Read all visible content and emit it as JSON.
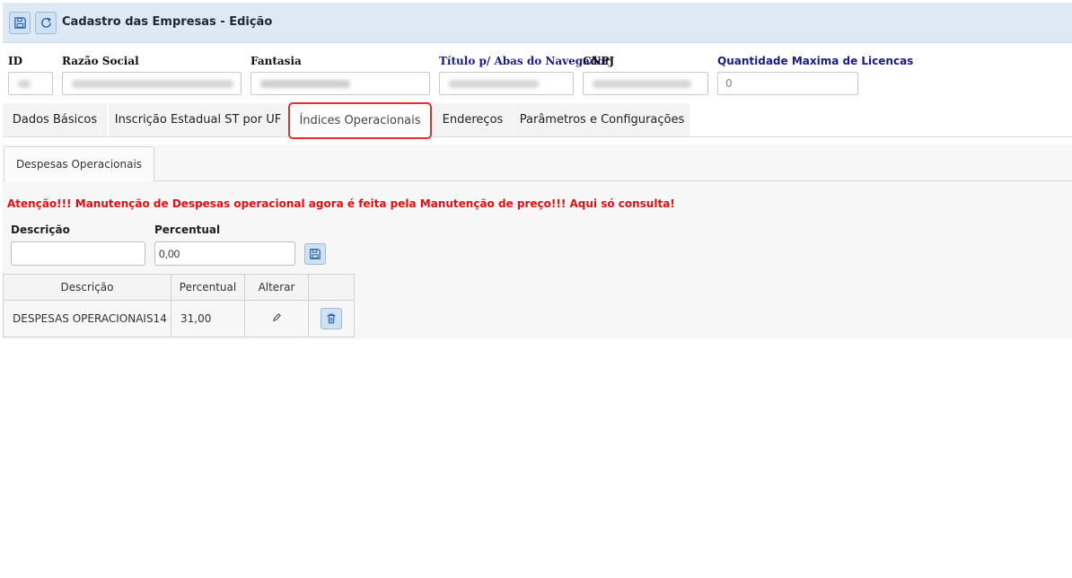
{
  "header": {
    "title": "Cadastro das Empresas - Edição"
  },
  "form": {
    "id_label": "ID",
    "razao_label": "Razão Social",
    "fantasia_label": "Fantasia",
    "titulo_label": "Título p/ Abas do Navegador",
    "cnpj_label": "CNPJ",
    "qtd_label": "Quantidade Maxima de Licencas",
    "qtd_value": "0"
  },
  "tabs": [
    {
      "label": "Dados Básicos"
    },
    {
      "label": "Inscrição Estadual ST por UF"
    },
    {
      "label": "Índices Operacionais"
    },
    {
      "label": "Endereços"
    },
    {
      "label": "Parâmetros e Configurações"
    }
  ],
  "subtab": {
    "label": "Despesas Operacionais"
  },
  "warning": "Atenção!!! Manutenção de Despesas operacional agora é feita pela Manutenção de preço!!! Aqui só consulta!",
  "entry": {
    "descricao_label": "Descrição",
    "percentual_label": "Percentual",
    "descricao_value": "",
    "percentual_value": "0,00"
  },
  "table": {
    "headers": [
      "Descrição",
      "Percentual",
      "Alterar",
      ""
    ],
    "rows": [
      {
        "descricao": "DESPESAS OPERACIONAIS14",
        "percentual": "31,00"
      }
    ]
  },
  "colors": {
    "accent": "#dde9f5",
    "warning": "#e01010",
    "active_tab_border": "#e03030"
  }
}
